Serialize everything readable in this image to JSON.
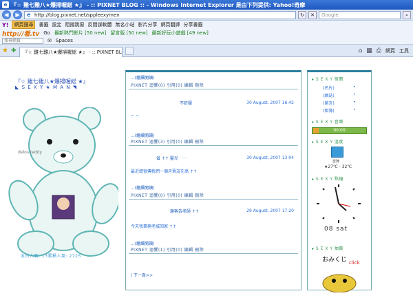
{
  "window": {
    "title": "『☆ 雞七雞八★爆掃喔総 ★』 - :: PIXNET BLOG :: - Windows Internet Explorer 是由下列提供: Yahoo!奇摩"
  },
  "address_bar": {
    "url": "http://blog.pixnet.net/sppleexymen",
    "search_placeholder": "Google"
  },
  "toolbar1": {
    "logo": "Y!",
    "items": [
      "網頁搜尋",
      "書籤",
      "設定",
      "阻擋跳窗",
      "反間諜軟體",
      "無名小站",
      "影片分享",
      "網頁翻譯",
      "分享書籤"
    ]
  },
  "toolbar2": {
    "logo": "http://看.tv",
    "go_label": "Go",
    "items": [
      "最新熱門影片 [50 new]",
      "留言版 [50 new]",
      "最新好玩小遊戲 [49 new]"
    ]
  },
  "toolbar3": {
    "search_placeholder": "搜尋網頁",
    "spaces_label": "Spaces"
  },
  "tabbar": {
    "tab_label": "『☆ 雞七雞八★爆掃喔総 ★』 - :: PIXNET BLO...",
    "page_label": "網頁",
    "tools_label": "工具"
  },
  "blog": {
    "title": "『☆ 雞七雞八★爆掃喔総 ★』",
    "subtitle": "◣ S E X Y ★ M A N ◥",
    "teddy_caption": "delos teddy",
    "counter": "本日人氣: 13累積人氣: 2725"
  },
  "posts": [
    {
      "read_more": "...(繼續閱讀)",
      "footer": "PIXNET  迴響(0) 引用(0) 編輯  刪除",
      "title": "",
      "date": "",
      "body": ""
    },
    {
      "read_more": "...(繼續閱讀)",
      "footer": "PIXNET  迴響(3) 引用(0) 編輯  刪除",
      "title": "不舒服",
      "date": "30 August, 2007 16:42",
      "body": "^ ^"
    },
    {
      "read_more": "...(繼續閱讀)",
      "footer": "PIXNET  迴響(0) 引用(0) 編輯  刪除",
      "title": "省  ↑↑  靈光  ·  ·  ·",
      "date": "30 August, 2007 13:04",
      "body": "最近總很傳我們一個月賣這を高  ↑↑"
    },
    {
      "read_more": "...(繼續閱讀)",
      "footer": "PIXNET  迴響(1) 引用(0) 編輯  刪除",
      "title": "謝客告老師  ↑↑",
      "date": "29 August, 2007 17:20",
      "body": "今天我業務老城回家  ↑↑"
    }
  ],
  "pager": "| 下一頁>>",
  "sidebar": {
    "sections": [
      {
        "head": "S E X Y 檢閱",
        "links": [
          "(名片)",
          "(網誌)",
          "(留言)",
          "(相簿)"
        ]
      },
      {
        "head": "S E X Y 音樂"
      },
      {
        "head": "S E X Y 溫度"
      },
      {
        "head": "S E X Y 點鐘"
      },
      {
        "head": "S E X Y 抽籤"
      }
    ],
    "music_time": "00:00",
    "weather_label": "雷陣",
    "weather_temp": "★27℃ - 32℃",
    "clock_date": "08 sat",
    "omikuji_label": "おみくじ",
    "omikuji_click": "click"
  },
  "colors": {
    "link": "#2a6fd6",
    "panel_border": "#2c7ea0",
    "sidebar_head": "#3b9a5a"
  }
}
